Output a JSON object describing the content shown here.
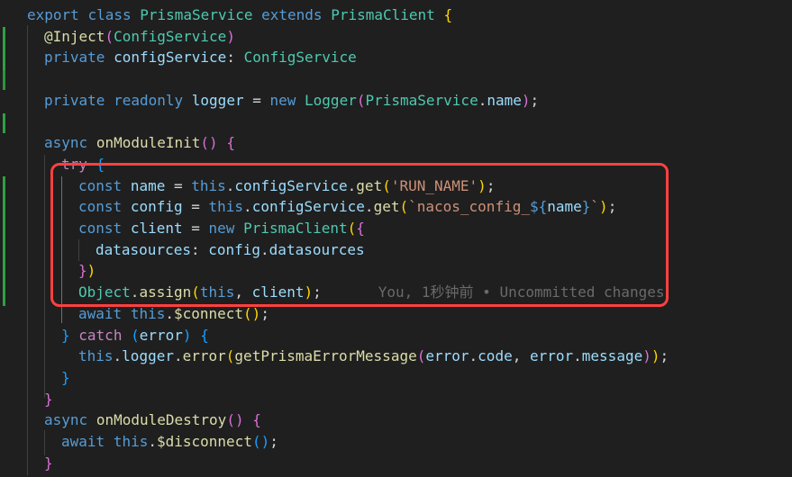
{
  "editor": {
    "lines": [
      [
        [
          "kw",
          "export"
        ],
        [
          "plain",
          " "
        ],
        [
          "kw",
          "class"
        ],
        [
          "plain",
          " "
        ],
        [
          "cls",
          "PrismaService"
        ],
        [
          "plain",
          " "
        ],
        [
          "kw",
          "extends"
        ],
        [
          "plain",
          " "
        ],
        [
          "cls",
          "PrismaClient"
        ],
        [
          "plain",
          " "
        ],
        [
          "br1",
          "{"
        ]
      ],
      [
        [
          "fn",
          "@Inject"
        ],
        [
          "br2",
          "("
        ],
        [
          "cls",
          "ConfigService"
        ],
        [
          "br2",
          ")"
        ]
      ],
      [
        [
          "kw",
          "private"
        ],
        [
          "plain",
          " "
        ],
        [
          "var",
          "configService"
        ],
        [
          "plain",
          ": "
        ],
        [
          "cls",
          "ConfigService"
        ]
      ],
      [],
      [
        [
          "kw",
          "private"
        ],
        [
          "plain",
          " "
        ],
        [
          "kw",
          "readonly"
        ],
        [
          "plain",
          " "
        ],
        [
          "var",
          "logger"
        ],
        [
          "plain",
          " = "
        ],
        [
          "kw",
          "new"
        ],
        [
          "plain",
          " "
        ],
        [
          "cls",
          "Logger"
        ],
        [
          "br2",
          "("
        ],
        [
          "cls",
          "PrismaService"
        ],
        [
          "plain",
          "."
        ],
        [
          "var",
          "name"
        ],
        [
          "br2",
          ")"
        ],
        [
          "plain",
          ";"
        ]
      ],
      [],
      [
        [
          "kw",
          "async"
        ],
        [
          "plain",
          " "
        ],
        [
          "fn",
          "onModuleInit"
        ],
        [
          "br2",
          "()"
        ],
        [
          "plain",
          " "
        ],
        [
          "br2",
          "{"
        ]
      ],
      [
        [
          "ctrl",
          "try"
        ],
        [
          "plain",
          " "
        ],
        [
          "br3",
          "{"
        ]
      ],
      [
        [
          "kw",
          "const"
        ],
        [
          "plain",
          " "
        ],
        [
          "var",
          "name"
        ],
        [
          "plain",
          " = "
        ],
        [
          "kw",
          "this"
        ],
        [
          "plain",
          "."
        ],
        [
          "var",
          "configService"
        ],
        [
          "plain",
          "."
        ],
        [
          "fn",
          "get"
        ],
        [
          "br1",
          "("
        ],
        [
          "str",
          "'RUN_NAME'"
        ],
        [
          "br1",
          ")"
        ],
        [
          "plain",
          ";"
        ]
      ],
      [
        [
          "kw",
          "const"
        ],
        [
          "plain",
          " "
        ],
        [
          "var",
          "config"
        ],
        [
          "plain",
          " = "
        ],
        [
          "kw",
          "this"
        ],
        [
          "plain",
          "."
        ],
        [
          "var",
          "configService"
        ],
        [
          "plain",
          "."
        ],
        [
          "fn",
          "get"
        ],
        [
          "br1",
          "("
        ],
        [
          "str",
          "`nacos_config_"
        ],
        [
          "kw",
          "${"
        ],
        [
          "var",
          "name"
        ],
        [
          "kw",
          "}"
        ],
        [
          "str",
          "`"
        ],
        [
          "br1",
          ")"
        ],
        [
          "plain",
          ";"
        ]
      ],
      [
        [
          "kw",
          "const"
        ],
        [
          "plain",
          " "
        ],
        [
          "var",
          "client"
        ],
        [
          "plain",
          " = "
        ],
        [
          "kw",
          "new"
        ],
        [
          "plain",
          " "
        ],
        [
          "cls",
          "PrismaClient"
        ],
        [
          "br1",
          "("
        ],
        [
          "br2",
          "{"
        ]
      ],
      [
        [
          "var",
          "datasources"
        ],
        [
          "plain",
          ": "
        ],
        [
          "var",
          "config"
        ],
        [
          "plain",
          "."
        ],
        [
          "var",
          "datasources"
        ]
      ],
      [
        [
          "br2",
          "}"
        ],
        [
          "br1",
          ")"
        ]
      ],
      [
        [
          "cls",
          "Object"
        ],
        [
          "plain",
          "."
        ],
        [
          "fn",
          "assign"
        ],
        [
          "br1",
          "("
        ],
        [
          "kw",
          "this"
        ],
        [
          "plain",
          ", "
        ],
        [
          "var",
          "client"
        ],
        [
          "br1",
          ")"
        ],
        [
          "plain",
          ";"
        ]
      ],
      [
        [
          "kw",
          "await"
        ],
        [
          "plain",
          " "
        ],
        [
          "kw",
          "this"
        ],
        [
          "plain",
          "."
        ],
        [
          "fn",
          "$connect"
        ],
        [
          "br1",
          "()"
        ],
        [
          "plain",
          ";"
        ]
      ],
      [
        [
          "br3",
          "}"
        ],
        [
          "plain",
          " "
        ],
        [
          "ctrl",
          "catch"
        ],
        [
          "plain",
          " "
        ],
        [
          "br3",
          "("
        ],
        [
          "var",
          "error"
        ],
        [
          "br3",
          ")"
        ],
        [
          "plain",
          " "
        ],
        [
          "br3",
          "{"
        ]
      ],
      [
        [
          "kw",
          "this"
        ],
        [
          "plain",
          "."
        ],
        [
          "var",
          "logger"
        ],
        [
          "plain",
          "."
        ],
        [
          "fn",
          "error"
        ],
        [
          "br1",
          "("
        ],
        [
          "fn",
          "getPrismaErrorMessage"
        ],
        [
          "br2",
          "("
        ],
        [
          "var",
          "error"
        ],
        [
          "plain",
          "."
        ],
        [
          "var",
          "code"
        ],
        [
          "plain",
          ", "
        ],
        [
          "var",
          "error"
        ],
        [
          "plain",
          "."
        ],
        [
          "var",
          "message"
        ],
        [
          "br2",
          ")"
        ],
        [
          "br1",
          ")"
        ],
        [
          "plain",
          ";"
        ]
      ],
      [
        [
          "br3",
          "}"
        ]
      ],
      [
        [
          "br2",
          "}"
        ]
      ],
      [
        [
          "kw",
          "async"
        ],
        [
          "plain",
          " "
        ],
        [
          "fn",
          "onModuleDestroy"
        ],
        [
          "br2",
          "()"
        ],
        [
          "plain",
          " "
        ],
        [
          "br2",
          "{"
        ]
      ],
      [
        [
          "kw",
          "await"
        ],
        [
          "plain",
          " "
        ],
        [
          "kw",
          "this"
        ],
        [
          "plain",
          "."
        ],
        [
          "fn",
          "$disconnect"
        ],
        [
          "br3",
          "()"
        ],
        [
          "plain",
          ";"
        ]
      ],
      [
        [
          "br2",
          "}"
        ]
      ]
    ],
    "blame": "You, 1秒钟前 • Uncommitted changes"
  }
}
